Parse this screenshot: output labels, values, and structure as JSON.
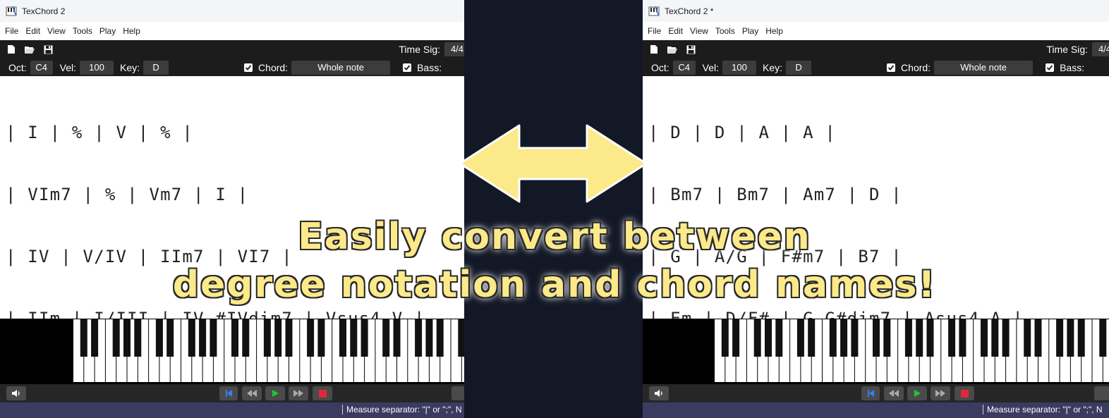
{
  "menu": [
    "File",
    "Edit",
    "View",
    "Tools",
    "Play",
    "Help"
  ],
  "toolbar": {
    "time_sig_label": "Time Sig:",
    "time_sig_value": "4/4"
  },
  "options": {
    "oct_label": "Oct:",
    "oct_value": "C4",
    "vel_label": "Vel:",
    "vel_value": "100",
    "key_label": "Key:",
    "key_value": "D",
    "chord_label": "Chord:",
    "chord_value": "Whole note",
    "bass_label": "Bass:"
  },
  "left": {
    "title": "TexChord 2",
    "lines": [
      "| I | % | V | % |",
      "| VIm7 | % | Vm7 | I |",
      "| IV | V/IV | IIm7 | VI7 |",
      "| IIm | I/III | IV #IVdim7 | Vsus4 V |"
    ]
  },
  "right": {
    "title": "TexChord 2 *",
    "lines": [
      "| D | D | A | A |",
      "| Bm7 | Bm7 | Am7 | D |",
      "| G | A/G | F#m7 | B7 |",
      "| Em | D/F# | G G#dim7 | Asus4 A |"
    ]
  },
  "status": "Measure separator: \"|\" or \";\", N",
  "caption": {
    "line1": "Easily convert between",
    "line2": "degree notation and chord names!"
  },
  "colors": {
    "toolbar_bg": "#1c1c1c",
    "statusbar_bg": "#3b3b62",
    "arrow_fill": "#fce98a",
    "play_green": "#22c43a",
    "stop_red": "#e0283c",
    "skip_blue": "#3a7bff"
  },
  "icons": [
    "new-file-icon",
    "open-folder-icon",
    "save-icon",
    "speaker-icon",
    "skip-start-icon",
    "rewind-icon",
    "play-icon",
    "fast-forward-icon",
    "stop-icon"
  ]
}
